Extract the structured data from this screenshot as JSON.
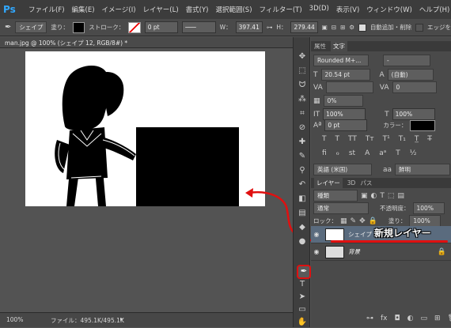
{
  "app": {
    "logo": "Ps"
  },
  "menu": [
    "ファイル(F)",
    "編集(E)",
    "イメージ(I)",
    "レイヤー(L)",
    "書式(Y)",
    "選択範囲(S)",
    "フィルター(T)",
    "3D(D)",
    "表示(V)",
    "ウィンドウ(W)",
    "ヘルプ(H)"
  ],
  "options": {
    "mode": "シェイプ",
    "fill_label": "塗り：",
    "stroke_label": "ストローク：",
    "stroke_size": "0 pt",
    "w_label": "W：",
    "w_value": "397.41",
    "h_label": "H：",
    "h_value": "279.44",
    "auto_add_delete": "自動追加・削除",
    "edge_label": "エッジを"
  },
  "document": {
    "tab": "man.jpg @ 100% (シェイプ 12, RGB/8#) *",
    "zoom": "100%",
    "file_info": "ファイル：495.1K/495.1K"
  },
  "character_panel": {
    "tabs": [
      "属性",
      "文字"
    ],
    "font": "Rounded M+...",
    "style": "-",
    "size": "20.54 pt",
    "leading": "(自動)",
    "tracking": "0",
    "kerning": "0%",
    "vscale": "100%",
    "hscale": "100%",
    "baseline": "0 pt",
    "color_label": "カラー：",
    "language": "英語 (米国)",
    "antialias": "鮮明"
  },
  "layers_panel": {
    "tabs": [
      "レイヤー",
      "3D",
      "パス"
    ],
    "filter": "種類",
    "blend": "通常",
    "opacity_label": "不透明度：",
    "opacity": "100%",
    "lock_label": "ロック：",
    "fill_label": "塗り：",
    "fill": "100%",
    "layers": [
      {
        "name": "シェイプ 12"
      },
      {
        "name": "背景"
      }
    ]
  },
  "annotation": "新規レイヤー",
  "colors": {
    "annotation_red": "#e01010",
    "accent": "#31a8ff"
  }
}
